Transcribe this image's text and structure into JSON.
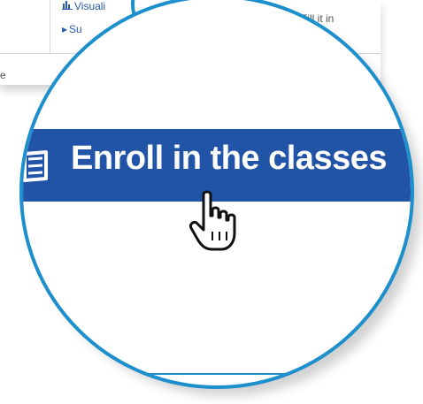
{
  "background_table": {
    "cell_visualize": "Visuali",
    "cell_summary": "Su",
    "cell_fill": "Fill it in",
    "cell_left_fragment": "e"
  },
  "magnified": {
    "button_label": "Enroll in the classes"
  },
  "colors": {
    "accent": "#1d8fcc",
    "button_bg": "#2153a6",
    "button_text": "#ffffff"
  }
}
